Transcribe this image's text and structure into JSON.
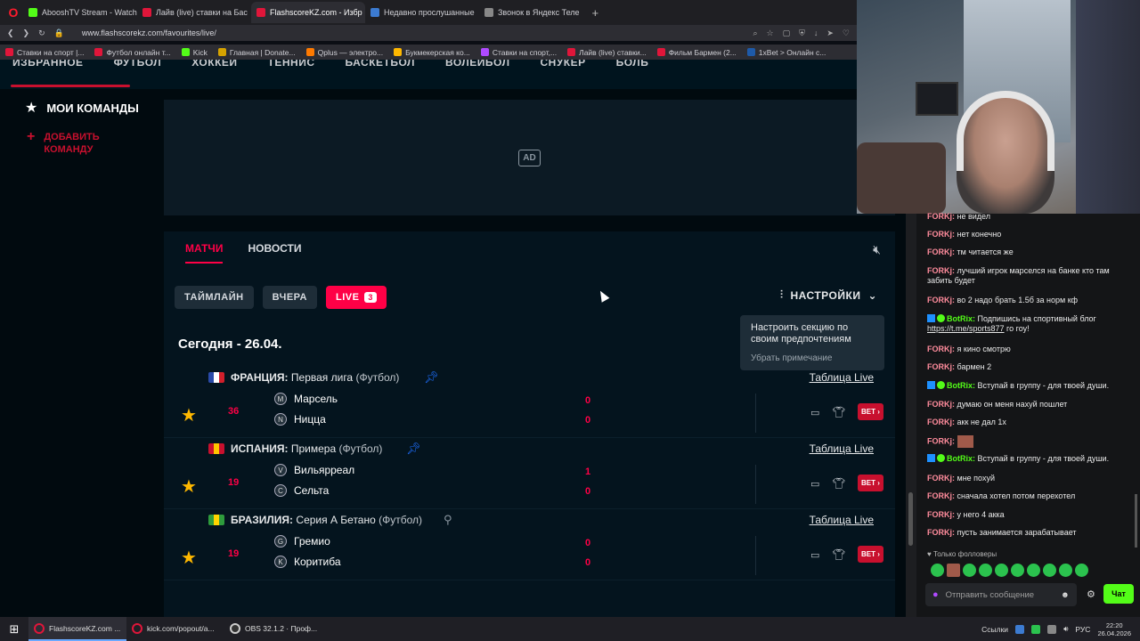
{
  "browser": {
    "tabs": [
      {
        "title": "AbooshTV Stream - Watch",
        "color": "#53fc18",
        "active": false
      },
      {
        "title": "Лайв (live) ставки на Бас",
        "color": "#e0163a",
        "active": false
      },
      {
        "title": "FlashscoreKZ.com - Избр",
        "color": "#e0163a",
        "active": true
      },
      {
        "title": "Недавно прослушанные",
        "color": "#3c7bd1",
        "active": false
      },
      {
        "title": "Звонок в Яндекс Теле",
        "color": "#888888",
        "active": false
      }
    ],
    "new_tab": "+",
    "url": "www.flashscorekz.com/favourites/live/",
    "bookmarks": [
      {
        "label": "Ставки на спорт |...",
        "color": "#e0163a"
      },
      {
        "label": "Футбол онлайн т...",
        "color": "#e0163a"
      },
      {
        "label": "Kick",
        "color": "#53fc18"
      },
      {
        "label": "Главная | Donate...",
        "color": "#d6a300"
      },
      {
        "label": "Qplus — электро...",
        "color": "#ff7a00"
      },
      {
        "label": "Букмекерская ко...",
        "color": "#ffb800"
      },
      {
        "label": "Ставки на спорт,...",
        "color": "#b04aff"
      },
      {
        "label": "Лайв (live) ставки...",
        "color": "#e0163a"
      },
      {
        "label": "Фильм Бармен (2...",
        "color": "#e0163a"
      },
      {
        "label": "1xBet > Онлайн с...",
        "color": "#1e5aa8"
      }
    ]
  },
  "flashscore": {
    "sport_nav": [
      "ИЗБРАННОЕ",
      "ФУТБОЛ",
      "ХОККЕЙ",
      "ТЕННИС",
      "БАСКЕТБОЛ",
      "ВОЛЕЙБОЛ",
      "СНУКЕР",
      "БОЛЬ"
    ],
    "my_teams": "МОИ КОМАНДЫ",
    "add_team": "ДОБАВИТЬ КОМАНДУ",
    "ad_label": "AD",
    "tabs": {
      "matches": "МАТЧИ",
      "news": "НОВОСТИ"
    },
    "filters": {
      "timeline": "ТАЙМЛАЙН",
      "yesterday": "ВЧЕРА",
      "live": "LIVE",
      "live_count": "3"
    },
    "settings": "НАСТРОЙКИ",
    "tooltip": {
      "text": "Настроить секцию по своим предпочтениям",
      "dismiss": "Убрать примечание"
    },
    "date_heading": "Сегодня - 26.04.",
    "table_live": "Таблица Live",
    "bet_label": "BET",
    "leagues": [
      {
        "country": "ФРАНЦИЯ:",
        "name": "Первая лига",
        "sport": "(Футбол)",
        "pinned": true,
        "match": {
          "minute": "36",
          "home": "Марсель",
          "away": "Ницца",
          "home_score": "0",
          "away_score": "0",
          "home_crest": "M",
          "away_crest": "N"
        }
      },
      {
        "country": "ИСПАНИЯ:",
        "name": "Примера",
        "sport": "(Футбол)",
        "pinned": true,
        "match": {
          "minute": "19",
          "home": "Вильярреал",
          "away": "Сельта",
          "home_score": "1",
          "away_score": "0",
          "home_crest": "V",
          "away_crest": "C"
        }
      },
      {
        "country": "БРАЗИЛИЯ:",
        "name": "Серия А Бетано",
        "sport": "(Футбол)",
        "pinned": false,
        "match": {
          "minute": "19",
          "home": "Гремио",
          "away": "Коритиба",
          "home_score": "0",
          "away_score": "0",
          "home_crest": "G",
          "away_crest": "K"
        }
      }
    ]
  },
  "chat": {
    "messages": [
      {
        "user": "FORKj:",
        "text": "не видел",
        "bot": false
      },
      {
        "user": "FORKj:",
        "text": "нет конечно",
        "bot": false
      },
      {
        "user": "FORKj:",
        "text": "тм читается же",
        "bot": false
      },
      {
        "user": "FORKj:",
        "text": "лучший игрок марселся на банке кто там забить будет",
        "bot": false
      },
      {
        "user": "FORKj:",
        "text": "во 2 надо брать 1.5б за норм кф",
        "bot": false
      },
      {
        "user": "BotRix:",
        "text": "Подпишись на спортивный блог",
        "link": "https://t.me/sports877",
        "suffix": " го гоу!",
        "bot": true
      },
      {
        "user": "FORKj:",
        "text": "я кино смотрю",
        "bot": false
      },
      {
        "user": "FORKj:",
        "text": "бармен 2",
        "bot": false
      },
      {
        "user": "BotRix:",
        "text": "Вступай в группу - для твоей души.",
        "bot": true
      },
      {
        "user": "FORKj:",
        "text": "думаю он меня нахуй пошлет",
        "bot": false
      },
      {
        "user": "FORKj:",
        "text": "акк не дал 1х",
        "bot": false
      },
      {
        "user": "FORKj:",
        "text": "",
        "emote": true,
        "bot": false
      },
      {
        "user": "BotRix:",
        "text": "Вступай в группу - для твоей души.",
        "bot": true
      },
      {
        "user": "FORKj:",
        "text": "мне похуй",
        "bot": false
      },
      {
        "user": "FORKj:",
        "text": "сначала хотел потом перехотел",
        "bot": false
      },
      {
        "user": "FORKj:",
        "text": "у него 4 акка",
        "bot": false
      },
      {
        "user": "FORKj:",
        "text": "пусть занимается зарабатывает",
        "bot": false
      }
    ],
    "followers_only": "♥ Только фолловеры",
    "input_placeholder": "Отправить сообщение",
    "send_label": "Чат"
  },
  "taskbar": {
    "items": [
      {
        "label": "FlashscoreKZ.com ...",
        "active": true
      },
      {
        "label": "kick.com/popout/a...",
        "active": false
      },
      {
        "label": "OBS 32.1.2 · Проф...",
        "active": false
      }
    ],
    "links_label": "Ссылки",
    "lang": "РУС",
    "time": "22:20",
    "date": "26.04.2026"
  }
}
